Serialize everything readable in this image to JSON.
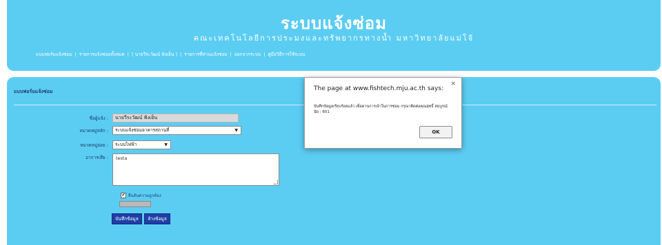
{
  "header": {
    "title": "ระบบแจ้งซ่อม",
    "subtitle": "คณะเทคโนโลยีการประมงและทรัพยากรทางน้ำ มหาวิทยาลัยแม่โจ้",
    "nav": [
      "แบบฟอร์มแจ้งซ่อม",
      "รายการแจ้งซ่อมทั้งหมด",
      "[ นายวีระวัฒน์ ฟังเย็น ]",
      "รายการที่ท่านแจ้งซ่อม",
      "ออกจากระบบ",
      "คู่มือวิธีการใช้ระบบ"
    ]
  },
  "form": {
    "section_title": "แบบฟอร์มแจ้งซ่อม",
    "reporter_label": "ชื่อผู้แจ้ง :",
    "reporter_value": "นายวีระวัฒน์ ฟังเย็น",
    "main_category_label": "หมวดหมู่หลัก :",
    "main_category_value": "ระบบแจ้งซ่อมอาคารสถานที่",
    "sub_category_label": "หมวดหมู่ย่อย :",
    "sub_category_value": "ระบบไฟฟ้า",
    "symptom_label": "อาการเสีย :",
    "symptom_value": "testa",
    "confirm_label": "ยืนยันความถูกต้อง",
    "save_button": "บันทึกข้อมูล",
    "clear_button": "ล้างข้อมูล",
    "arrow_glyph": "▼",
    "check_glyph": "✔"
  },
  "dialog": {
    "title": "The page at www.fishtech.mju.ac.th says:",
    "message": "บันทึกข้อมูลเรียบร้อยแล้ว เพื่อดานการเจ้าในการซ่อม กรุณาติดต่อคุณสุทธิ์ สมบูรณ์นัย : 601",
    "ok_label": "OK",
    "close_glyph": "×"
  }
}
